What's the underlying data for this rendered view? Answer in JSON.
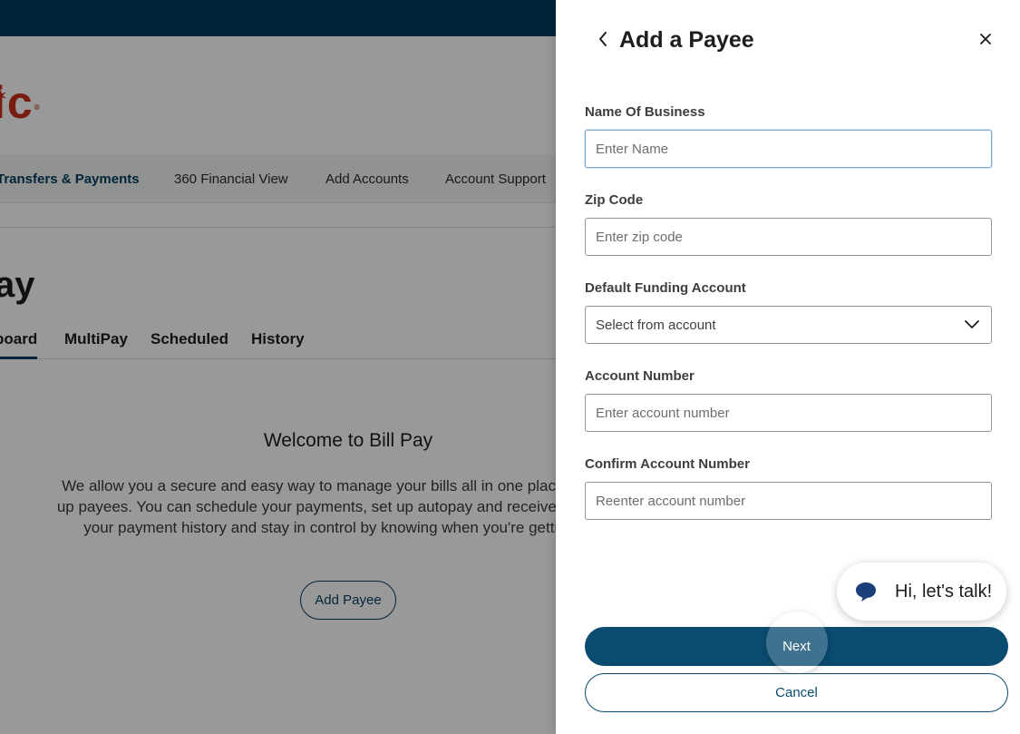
{
  "background": {
    "logo_text": "ic",
    "logo_star": "✶",
    "logo_reg": "®",
    "nav_items": [
      {
        "label": "Transfers & Payments"
      },
      {
        "label": "360 Financial View"
      },
      {
        "label": "Add Accounts"
      },
      {
        "label": "Account Support"
      }
    ],
    "page_heading": "ay",
    "tabs": [
      {
        "label": "board"
      },
      {
        "label": "MultiPay"
      },
      {
        "label": "Scheduled"
      },
      {
        "label": "History"
      }
    ],
    "welcome_title": "Welcome to Bill Pay",
    "welcome_body": "We allow you a secure and easy way to manage your bills all in one place by setting up payees. You can schedule your payments, set up autopay and receive eBills! View your payment history and stay in control by knowing when you're getting paid.",
    "add_payee_label": "Add Payee"
  },
  "panel": {
    "title": "Add a Payee",
    "back_icon": "chevron-left-icon",
    "close_icon": "close-icon",
    "fields": {
      "business_name": {
        "label": "Name Of Business",
        "placeholder": "Enter Name",
        "value": ""
      },
      "zip_code": {
        "label": "Zip Code",
        "placeholder": "Enter zip code",
        "value": ""
      },
      "funding_account": {
        "label": "Default Funding Account",
        "selected": "Select from account"
      },
      "account_number": {
        "label": "Account Number",
        "placeholder": "Enter account number",
        "value": ""
      },
      "confirm_account_number": {
        "label": "Confirm Account Number",
        "placeholder": "Reenter account number",
        "value": ""
      }
    },
    "chat": {
      "label": "Hi, let's talk!",
      "icon": "chat-bubble-icon"
    },
    "next_label": "Next",
    "cancel_label": "Cancel"
  },
  "colors": {
    "brand_navy": "#023e5e",
    "button_primary": "#0a4b70",
    "logo_red": "#c8301f",
    "chat_icon": "#1a3f7a"
  }
}
